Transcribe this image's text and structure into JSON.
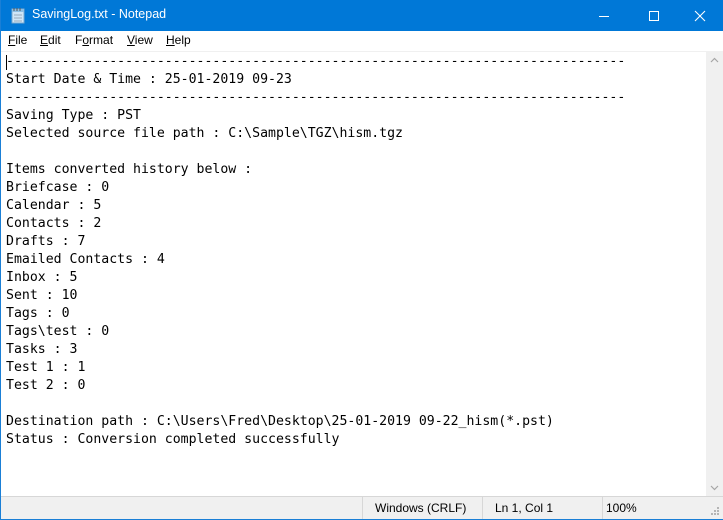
{
  "window": {
    "title": "SavingLog.txt - Notepad",
    "app_icon": "notepad-icon",
    "controls": [
      "minimize-icon",
      "maximize-icon",
      "close-icon"
    ]
  },
  "menu": {
    "items": [
      {
        "label": "File",
        "mnemonic": "F"
      },
      {
        "label": "Edit",
        "mnemonic": "E"
      },
      {
        "label": "Format",
        "mnemonic": "o"
      },
      {
        "label": "View",
        "mnemonic": "V"
      },
      {
        "label": "Help",
        "mnemonic": "H"
      }
    ]
  },
  "document": {
    "separator": "------------------------------------------------------------------------------",
    "start_label": "Start Date & Time : 25-01-2019 09-23",
    "saving_type": "Saving Type : PST",
    "source_path": "Selected source file path : C:\\Sample\\TGZ\\hism.tgz",
    "history_header": "Items converted history below :",
    "items": [
      {
        "name": "Briefcase",
        "count": 0
      },
      {
        "name": "Calendar",
        "count": 5
      },
      {
        "name": "Contacts",
        "count": 2
      },
      {
        "name": "Drafts",
        "count": 7
      },
      {
        "name": "Emailed Contacts",
        "count": 4
      },
      {
        "name": "Inbox",
        "count": 5
      },
      {
        "name": "Sent",
        "count": 10
      },
      {
        "name": "Tags",
        "count": 0
      },
      {
        "name": "Tags\\test",
        "count": 0
      },
      {
        "name": "Tasks",
        "count": 3
      },
      {
        "name": "Test 1",
        "count": 1
      },
      {
        "name": "Test 2",
        "count": 0
      }
    ],
    "destination": "Destination path : C:\\Users\\Fred\\Desktop\\25-01-2019 09-22_hism(*.pst)",
    "status": "Status : Conversion completed successfully"
  },
  "statusbar": {
    "line_ending": "Windows (CRLF)",
    "position": "Ln 1, Col 1",
    "zoom": "100%"
  },
  "colors": {
    "titlebar": "#0078d7",
    "chrome": "#f0f0f0"
  }
}
